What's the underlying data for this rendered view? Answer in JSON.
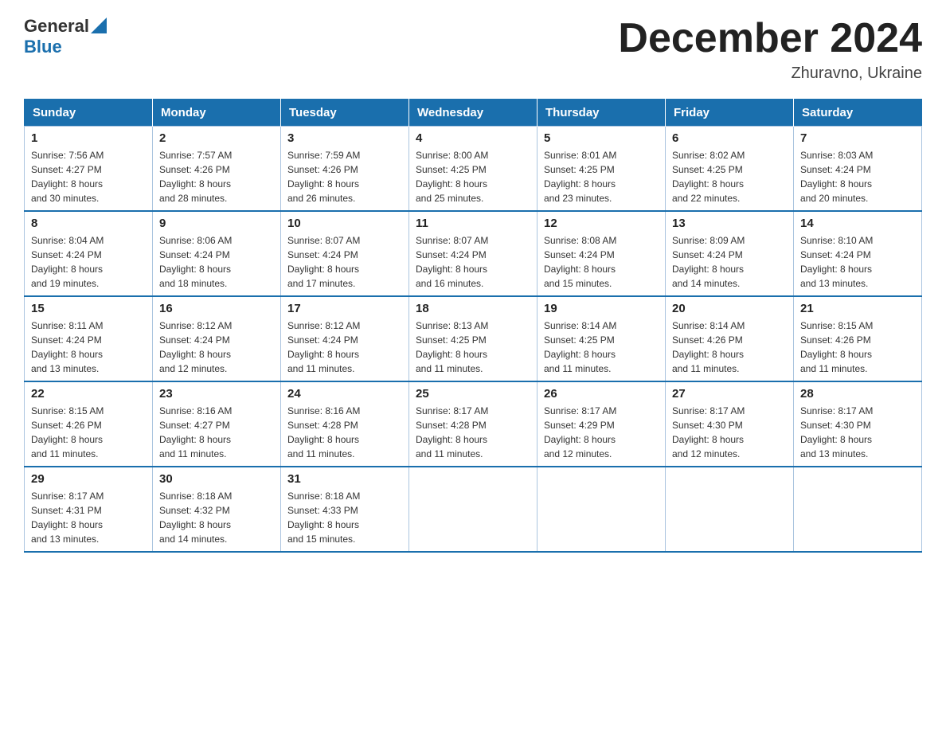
{
  "header": {
    "logo_general": "General",
    "logo_blue": "Blue",
    "month_title": "December 2024",
    "location": "Zhuravno, Ukraine"
  },
  "days_of_week": [
    "Sunday",
    "Monday",
    "Tuesday",
    "Wednesday",
    "Thursday",
    "Friday",
    "Saturday"
  ],
  "weeks": [
    [
      {
        "day": "1",
        "sunrise": "7:56 AM",
        "sunset": "4:27 PM",
        "daylight": "8 hours and 30 minutes."
      },
      {
        "day": "2",
        "sunrise": "7:57 AM",
        "sunset": "4:26 PM",
        "daylight": "8 hours and 28 minutes."
      },
      {
        "day": "3",
        "sunrise": "7:59 AM",
        "sunset": "4:26 PM",
        "daylight": "8 hours and 26 minutes."
      },
      {
        "day": "4",
        "sunrise": "8:00 AM",
        "sunset": "4:25 PM",
        "daylight": "8 hours and 25 minutes."
      },
      {
        "day": "5",
        "sunrise": "8:01 AM",
        "sunset": "4:25 PM",
        "daylight": "8 hours and 23 minutes."
      },
      {
        "day": "6",
        "sunrise": "8:02 AM",
        "sunset": "4:25 PM",
        "daylight": "8 hours and 22 minutes."
      },
      {
        "day": "7",
        "sunrise": "8:03 AM",
        "sunset": "4:24 PM",
        "daylight": "8 hours and 20 minutes."
      }
    ],
    [
      {
        "day": "8",
        "sunrise": "8:04 AM",
        "sunset": "4:24 PM",
        "daylight": "8 hours and 19 minutes."
      },
      {
        "day": "9",
        "sunrise": "8:06 AM",
        "sunset": "4:24 PM",
        "daylight": "8 hours and 18 minutes."
      },
      {
        "day": "10",
        "sunrise": "8:07 AM",
        "sunset": "4:24 PM",
        "daylight": "8 hours and 17 minutes."
      },
      {
        "day": "11",
        "sunrise": "8:07 AM",
        "sunset": "4:24 PM",
        "daylight": "8 hours and 16 minutes."
      },
      {
        "day": "12",
        "sunrise": "8:08 AM",
        "sunset": "4:24 PM",
        "daylight": "8 hours and 15 minutes."
      },
      {
        "day": "13",
        "sunrise": "8:09 AM",
        "sunset": "4:24 PM",
        "daylight": "8 hours and 14 minutes."
      },
      {
        "day": "14",
        "sunrise": "8:10 AM",
        "sunset": "4:24 PM",
        "daylight": "8 hours and 13 minutes."
      }
    ],
    [
      {
        "day": "15",
        "sunrise": "8:11 AM",
        "sunset": "4:24 PM",
        "daylight": "8 hours and 13 minutes."
      },
      {
        "day": "16",
        "sunrise": "8:12 AM",
        "sunset": "4:24 PM",
        "daylight": "8 hours and 12 minutes."
      },
      {
        "day": "17",
        "sunrise": "8:12 AM",
        "sunset": "4:24 PM",
        "daylight": "8 hours and 11 minutes."
      },
      {
        "day": "18",
        "sunrise": "8:13 AM",
        "sunset": "4:25 PM",
        "daylight": "8 hours and 11 minutes."
      },
      {
        "day": "19",
        "sunrise": "8:14 AM",
        "sunset": "4:25 PM",
        "daylight": "8 hours and 11 minutes."
      },
      {
        "day": "20",
        "sunrise": "8:14 AM",
        "sunset": "4:26 PM",
        "daylight": "8 hours and 11 minutes."
      },
      {
        "day": "21",
        "sunrise": "8:15 AM",
        "sunset": "4:26 PM",
        "daylight": "8 hours and 11 minutes."
      }
    ],
    [
      {
        "day": "22",
        "sunrise": "8:15 AM",
        "sunset": "4:26 PM",
        "daylight": "8 hours and 11 minutes."
      },
      {
        "day": "23",
        "sunrise": "8:16 AM",
        "sunset": "4:27 PM",
        "daylight": "8 hours and 11 minutes."
      },
      {
        "day": "24",
        "sunrise": "8:16 AM",
        "sunset": "4:28 PM",
        "daylight": "8 hours and 11 minutes."
      },
      {
        "day": "25",
        "sunrise": "8:17 AM",
        "sunset": "4:28 PM",
        "daylight": "8 hours and 11 minutes."
      },
      {
        "day": "26",
        "sunrise": "8:17 AM",
        "sunset": "4:29 PM",
        "daylight": "8 hours and 12 minutes."
      },
      {
        "day": "27",
        "sunrise": "8:17 AM",
        "sunset": "4:30 PM",
        "daylight": "8 hours and 12 minutes."
      },
      {
        "day": "28",
        "sunrise": "8:17 AM",
        "sunset": "4:30 PM",
        "daylight": "8 hours and 13 minutes."
      }
    ],
    [
      {
        "day": "29",
        "sunrise": "8:17 AM",
        "sunset": "4:31 PM",
        "daylight": "8 hours and 13 minutes."
      },
      {
        "day": "30",
        "sunrise": "8:18 AM",
        "sunset": "4:32 PM",
        "daylight": "8 hours and 14 minutes."
      },
      {
        "day": "31",
        "sunrise": "8:18 AM",
        "sunset": "4:33 PM",
        "daylight": "8 hours and 15 minutes."
      },
      null,
      null,
      null,
      null
    ]
  ],
  "labels": {
    "sunrise": "Sunrise:",
    "sunset": "Sunset:",
    "daylight": "Daylight:"
  }
}
